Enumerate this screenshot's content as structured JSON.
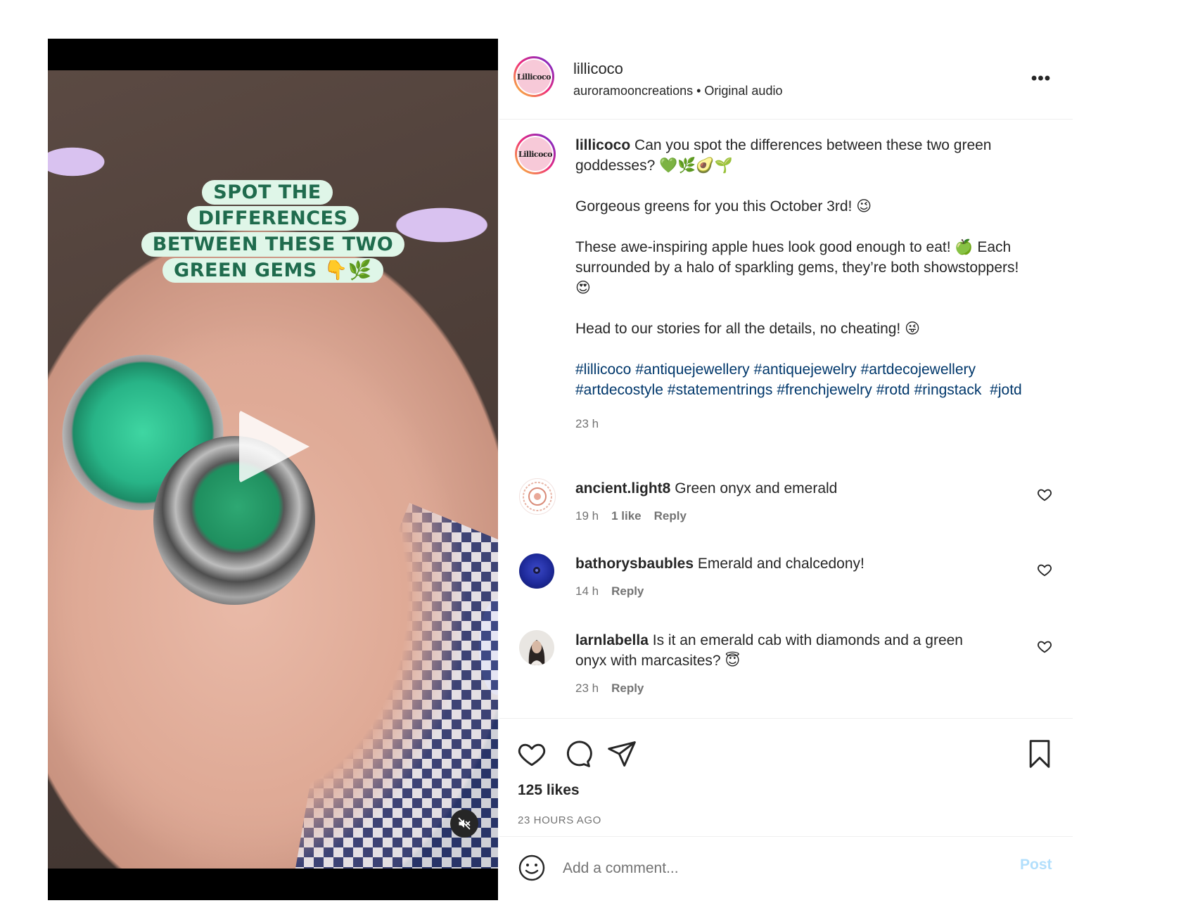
{
  "video": {
    "overlay_lines": [
      "SPOT THE DIFFERENCES",
      "BETWEEN THESE TWO",
      "GREEN GEMS 👇🌿"
    ]
  },
  "header": {
    "avatar_text": "Lillicoco",
    "username": "lillicoco",
    "audio": "auroramooncreations • Original audio",
    "more": "•••"
  },
  "caption": {
    "avatar_text": "Lillicoco",
    "username": "lillicoco",
    "lines": [
      "Can you spot the differences between these two green goddesses? 💚🌿🥑🌱",
      "Gorgeous greens for you this October 3rd! 😉",
      "These awe-inspiring apple hues look good enough to eat! 🍏 Each surrounded by a halo of sparkling gems, they’re both showstoppers! 😍",
      "Head to our stories for all the details, no cheating! 😜"
    ],
    "hashtags": [
      "#lillicoco",
      "#antiquejewellery",
      "#antiquejewelry",
      "#artdecojewellery",
      "#artdecostyle",
      "#statementrings",
      "#frenchjewelry",
      "#rotd",
      "#ringstack",
      "#jotd"
    ],
    "time": "23 h"
  },
  "comments": [
    {
      "username": "ancient.light8",
      "text": "Green onyx and emerald",
      "time": "19 h",
      "likes": "1 like",
      "reply": "Reply"
    },
    {
      "username": "bathorysbaubles",
      "text": "Emerald and chalcedony!",
      "time": "14 h",
      "reply": "Reply"
    },
    {
      "username": "larnlabella",
      "text": "Is it an emerald cab with diamonds and a green onyx with marcasites? 😇",
      "time": "23 h",
      "reply": "Reply"
    }
  ],
  "actions": {
    "likes": "125 likes",
    "posted": "23 HOURS AGO"
  },
  "comment_box": {
    "placeholder": "Add a comment...",
    "post_label": "Post"
  },
  "colors": {
    "link": "#00376b",
    "muted": "#737373",
    "post_disabled": "#b2dffc"
  }
}
